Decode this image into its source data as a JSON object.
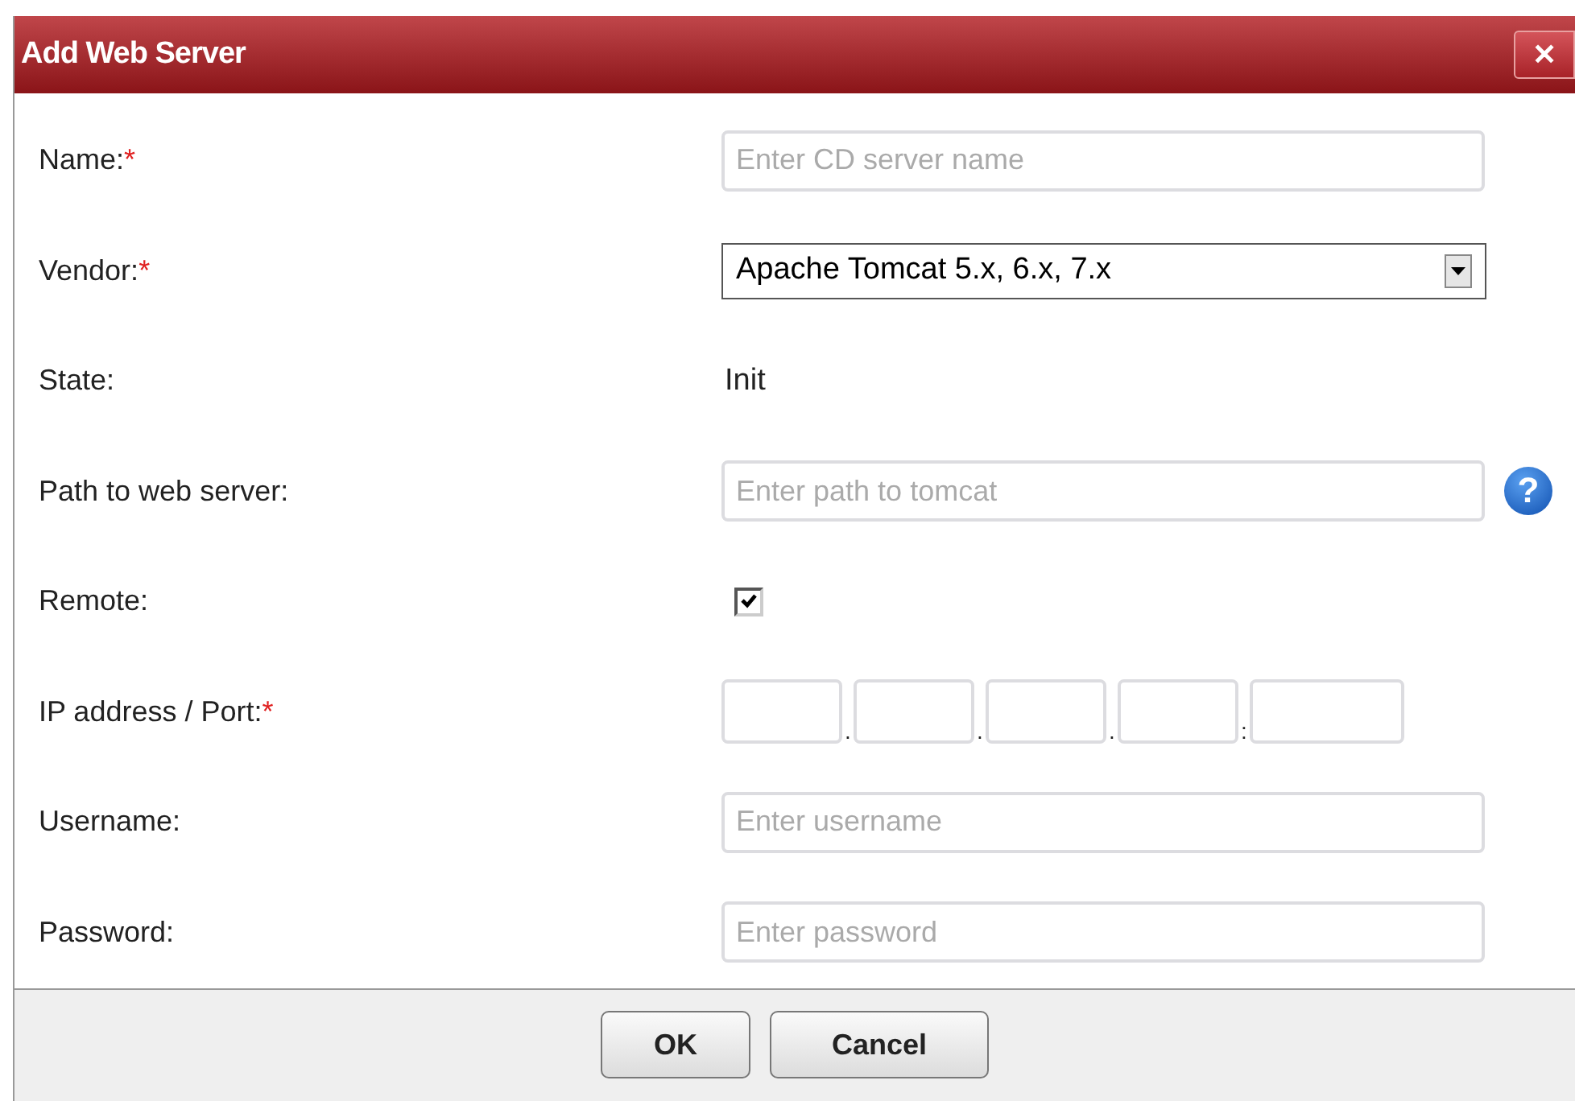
{
  "window": {
    "title": "Add Web Server",
    "close": "✕"
  },
  "rows": [
    {
      "kind": "text",
      "label": "Name:",
      "required": "*",
      "placeholder": "Enter CD server name"
    },
    {
      "kind": "select",
      "label": "Vendor:",
      "required": "*",
      "value": "Apache Tomcat 5.x, 6.x, 7.x"
    },
    {
      "kind": "static",
      "label": "State:",
      "value": "Init"
    },
    {
      "kind": "text",
      "label": "Path to web server:",
      "placeholder": "Enter path to tomcat",
      "help": "?"
    },
    {
      "kind": "checkbox",
      "label": "Remote:",
      "checked": true
    },
    {
      "kind": "ip",
      "label": "IP address / Port:",
      "required": "*",
      "separators": [
        ".",
        ".",
        ".",
        ":"
      ]
    },
    {
      "kind": "text",
      "label": "Username:",
      "placeholder": "Enter username"
    },
    {
      "kind": "text",
      "label": "Password:",
      "placeholder": "Enter password"
    }
  ],
  "buttons": [
    "OK",
    "Cancel"
  ]
}
